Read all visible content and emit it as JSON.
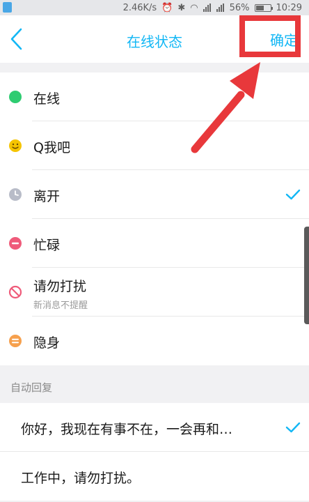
{
  "status_bar": {
    "speed": "2.46K/s",
    "battery": "56%",
    "battery_level": 0.56,
    "time": "10:29"
  },
  "nav": {
    "title": "在线状态",
    "confirm_label": "确定"
  },
  "statuses": [
    {
      "label": "在线",
      "icon": "online-dot-icon",
      "color": "#2ecc71",
      "selected": false
    },
    {
      "label": "Q我吧",
      "icon": "smile-face-icon",
      "color": "#f5c400",
      "selected": false
    },
    {
      "label": "离开",
      "icon": "clock-icon",
      "color": "#b8bcc8",
      "selected": true
    },
    {
      "label": "忙碌",
      "icon": "busy-minus-icon",
      "color": "#ef5b7a",
      "selected": false
    },
    {
      "label": "请勿打扰",
      "sublabel": "新消息不提醒",
      "icon": "do-not-disturb-icon",
      "color": "#ef5b7a",
      "selected": false
    },
    {
      "label": "隐身",
      "icon": "invisible-icon",
      "color": "#f6a04d",
      "selected": false
    }
  ],
  "auto_reply": {
    "section_label": "自动回复",
    "items": [
      {
        "label": "你好，我现在有事不在，一会再和…",
        "selected": true
      },
      {
        "label": "工作中，请勿打扰。",
        "selected": false
      }
    ]
  },
  "colors": {
    "accent": "#12b7f5",
    "highlight": "#e8383b"
  }
}
